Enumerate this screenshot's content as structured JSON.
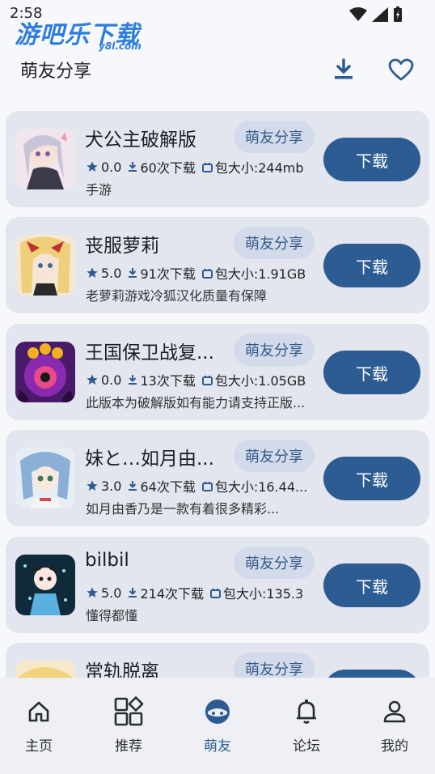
{
  "status_bar": {
    "time": "2:58"
  },
  "watermark": {
    "text": "游吧乐下载",
    "sub": "y8l.com"
  },
  "header": {
    "title": "萌友分享"
  },
  "apps": [
    {
      "name": "犬公主破解版",
      "tag": "萌友分享",
      "rating": "0.0",
      "downloads": "60次下载",
      "size": "包大小:244mb",
      "desc": "手游",
      "button": "下载"
    },
    {
      "name": "丧服萝莉",
      "tag": "萌友分享",
      "rating": "5.0",
      "downloads": "91次下载",
      "size": "包大小:1.91GB",
      "desc": "老萝莉游戏冷狐汉化质量有保障",
      "button": "下载"
    },
    {
      "name": "王国保卫战复...",
      "tag": "萌友分享",
      "rating": "0.0",
      "downloads": "13次下载",
      "size": "包大小:1.05GB",
      "desc": "此版本为破解版如有能力请支持正版...",
      "button": "下载"
    },
    {
      "name": "妹と…如月由...",
      "tag": "萌友分享",
      "rating": "3.0",
      "downloads": "64次下载",
      "size": "包大小:16.44...",
      "desc": "如月由香乃是一款有着很多精彩...",
      "button": "下载"
    },
    {
      "name": "bilbil",
      "tag": "萌友分享",
      "rating": "5.0",
      "downloads": "214次下载",
      "size": "包大小:135.3",
      "desc": "懂得都懂",
      "button": "下载"
    },
    {
      "name": "常轨脱离",
      "tag": "萌友分享",
      "rating": "",
      "downloads": "",
      "size": "",
      "desc": "",
      "button": ""
    }
  ],
  "nav": [
    {
      "label": "主页",
      "icon": "home-icon"
    },
    {
      "label": "推荐",
      "icon": "grid-icon"
    },
    {
      "label": "萌友",
      "icon": "face-icon"
    },
    {
      "label": "论坛",
      "icon": "bell-icon"
    },
    {
      "label": "我的",
      "icon": "person-icon"
    }
  ],
  "colors": {
    "accent": "#2d5c93",
    "card": "#e3e6ef",
    "tag": "#d3dbea"
  }
}
